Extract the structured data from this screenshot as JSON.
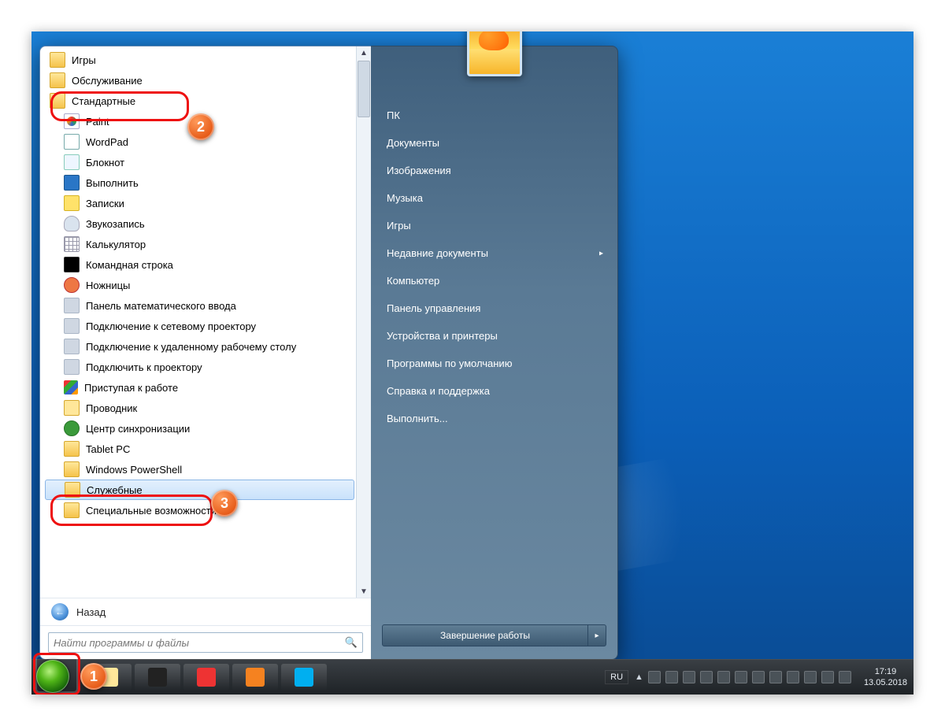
{
  "annotations": {
    "a1": "1",
    "a2": "2",
    "a3": "3"
  },
  "start_menu": {
    "programs": [
      {
        "label": "Игры",
        "icon": "folder",
        "indent": 0
      },
      {
        "label": "Обслуживание",
        "icon": "folder",
        "indent": 0
      },
      {
        "label": "Стандартные",
        "icon": "folder",
        "indent": 0,
        "ring": "r2"
      },
      {
        "label": "Paint",
        "icon": "paint",
        "indent": 1
      },
      {
        "label": "WordPad",
        "icon": "wordpad",
        "indent": 1
      },
      {
        "label": "Блокнот",
        "icon": "notepad",
        "indent": 1
      },
      {
        "label": "Выполнить",
        "icon": "run",
        "indent": 1
      },
      {
        "label": "Записки",
        "icon": "sticky",
        "indent": 1
      },
      {
        "label": "Звукозапись",
        "icon": "mic",
        "indent": 1
      },
      {
        "label": "Калькулятор",
        "icon": "calc",
        "indent": 1
      },
      {
        "label": "Командная строка",
        "icon": "cmd",
        "indent": 1
      },
      {
        "label": "Ножницы",
        "icon": "snip",
        "indent": 1
      },
      {
        "label": "Панель математического ввода",
        "icon": "generic",
        "indent": 1
      },
      {
        "label": "Подключение к сетевому проектору",
        "icon": "generic",
        "indent": 1
      },
      {
        "label": "Подключение к удаленному рабочему столу",
        "icon": "generic",
        "indent": 1
      },
      {
        "label": "Подключить к проектору",
        "icon": "generic",
        "indent": 1
      },
      {
        "label": "Приступая к работе",
        "icon": "flag",
        "indent": 1
      },
      {
        "label": "Проводник",
        "icon": "explorer",
        "indent": 1
      },
      {
        "label": "Центр синхронизации",
        "icon": "sync",
        "indent": 1
      },
      {
        "label": "Tablet PC",
        "icon": "folder",
        "indent": 1
      },
      {
        "label": "Windows PowerShell",
        "icon": "folder",
        "indent": 1
      },
      {
        "label": "Служебные",
        "icon": "folder",
        "indent": 1,
        "highlight": true,
        "ring": "r3"
      },
      {
        "label": "Специальные возможности",
        "icon": "folder",
        "indent": 1
      }
    ],
    "back_label": "Назад",
    "search_placeholder": "Найти программы и файлы",
    "right_items": [
      {
        "label": "ПК"
      },
      {
        "label": "Документы"
      },
      {
        "label": "Изображения"
      },
      {
        "label": "Музыка"
      },
      {
        "label": "Игры"
      },
      {
        "label": "Недавние документы",
        "sub": true
      },
      {
        "label": "Компьютер"
      },
      {
        "label": "Панель управления"
      },
      {
        "label": "Устройства и принтеры"
      },
      {
        "label": "Программы по умолчанию"
      },
      {
        "label": "Справка и поддержка"
      },
      {
        "label": "Выполнить..."
      }
    ],
    "shutdown_label": "Завершение работы"
  },
  "taskbar": {
    "apps": [
      {
        "name": "explorer",
        "color": "#ffe79a"
      },
      {
        "name": "panda",
        "color": "#222"
      },
      {
        "name": "opera",
        "color": "#e33"
      },
      {
        "name": "firefox",
        "color": "#f58220"
      },
      {
        "name": "skype",
        "color": "#00aff0"
      }
    ],
    "tray": {
      "lang": "RU",
      "icons": [
        "up",
        "net",
        "av",
        "java",
        "disk",
        "flag",
        "sig",
        "vol",
        "act",
        "a",
        "wifi",
        "spk"
      ],
      "time": "17:19",
      "date": "13.05.2018"
    }
  },
  "colors": {
    "accent": "#e11",
    "orange": "#e65a17"
  }
}
